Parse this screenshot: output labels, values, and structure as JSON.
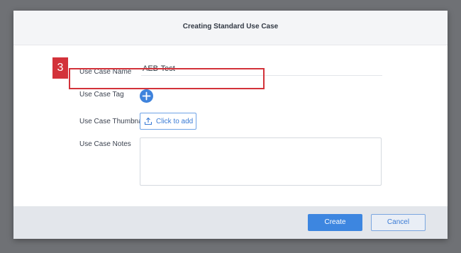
{
  "dialog": {
    "title": "Creating Standard Use Case"
  },
  "annotation": {
    "step_number": "3",
    "highlight_color": "#d3323a"
  },
  "form": {
    "name_label": "Use Case Name",
    "name_value": "AEB-Test",
    "tag_label": "Use Case Tag",
    "tag_add_icon": "plus-icon",
    "thumbnail_label": "Use Case Thumbnail",
    "thumbnail_button_label": "Click to add",
    "thumbnail_button_icon": "upload-icon",
    "notes_label": "Use Case Notes",
    "notes_value": ""
  },
  "footer": {
    "create_label": "Create",
    "cancel_label": "Cancel"
  },
  "colors": {
    "accent": "#3d86e0",
    "backdrop": "#6f7175"
  }
}
